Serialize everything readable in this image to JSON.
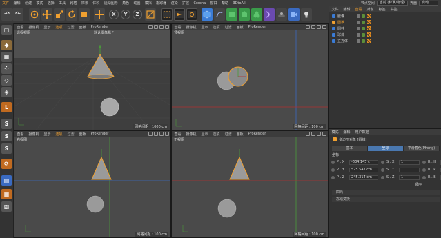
{
  "menubar": {
    "items": [
      "文件",
      "编辑",
      "创建",
      "模式",
      "选择",
      "工具",
      "网格",
      "样条",
      "体积",
      "运动图形",
      "角色",
      "动画",
      "模拟",
      "跟踪器",
      "渲染",
      "扩展",
      "Corona",
      "窗口",
      "帮助",
      "3DtoAll"
    ],
    "interface_label": "界面",
    "interface_value": "启动",
    "node_space_label": "节点空间",
    "node_space_value": "当前 (标准/物理)"
  },
  "toolbar": {
    "axis_x": "X",
    "axis_y": "Y",
    "axis_z": "Z"
  },
  "viewports": [
    {
      "menu": [
        "查看",
        "摄像机",
        "显示",
        "选项",
        "过滤",
        "面板",
        "ProRender"
      ],
      "title": "透视视图",
      "camera": "默认摄像机 *",
      "grid": "网格间距 : 1000 cm"
    },
    {
      "menu": [
        "查看",
        "摄像机",
        "显示",
        "选项",
        "过滤",
        "面板",
        "ProRender"
      ],
      "title": "顶视图",
      "camera": "",
      "grid": "网格间距 : 100 cm"
    },
    {
      "menu": [
        "查看",
        "摄像机",
        "显示",
        "选项",
        "过滤",
        "面板",
        "ProRender"
      ],
      "title": "右视图",
      "camera": "",
      "grid": "网格间距 : 100 cm"
    },
    {
      "menu": [
        "查看",
        "摄像机",
        "显示",
        "选项",
        "过滤",
        "面板",
        "ProRender"
      ],
      "title": "正视图",
      "camera": "",
      "grid": "网格间距 : 100 cm"
    }
  ],
  "object_manager": {
    "tabs": [
      "文件",
      "编辑",
      "查看",
      "对象",
      "标签",
      "书签"
    ],
    "active_tab": "查看",
    "objects": [
      {
        "name": "胶囊",
        "selected": false,
        "color": "#3a7bd5"
      },
      {
        "name": "圆锥",
        "selected": true,
        "color": "#f0a030"
      },
      {
        "name": "圆柱",
        "selected": false,
        "color": "#3a7bd5"
      },
      {
        "name": "球体",
        "selected": false,
        "color": "#3a7bd5"
      },
      {
        "name": "立方体",
        "selected": false,
        "color": "#3a7bd5"
      }
    ]
  },
  "attributes": {
    "tabs": [
      "模式",
      "编辑",
      "用户数据"
    ],
    "object_title": "多边形对象 [圆锥]",
    "mode_tabs": [
      "基本",
      "坐标",
      "平滑着色(Phong)"
    ],
    "active_mode_tab": "坐标",
    "coord_header": "坐标",
    "rows": [
      {
        "p_label": "P . X",
        "p_val": "-634.145 c",
        "s_label": "S . X",
        "s_val": "1",
        "r_label": "R . H",
        "r_val": "0"
      },
      {
        "p_label": "P . Y",
        "p_val": "525.547 cm",
        "s_label": "S . Y",
        "s_val": "1",
        "r_label": "R . P",
        "r_val": "0"
      },
      {
        "p_label": "P . Z",
        "p_val": "245.314 cm",
        "s_label": "S . Z",
        "s_val": "1",
        "r_label": "R . B",
        "r_val": "0"
      }
    ],
    "order_label": "顺序",
    "sections": [
      "四元",
      "冻结变换"
    ]
  }
}
